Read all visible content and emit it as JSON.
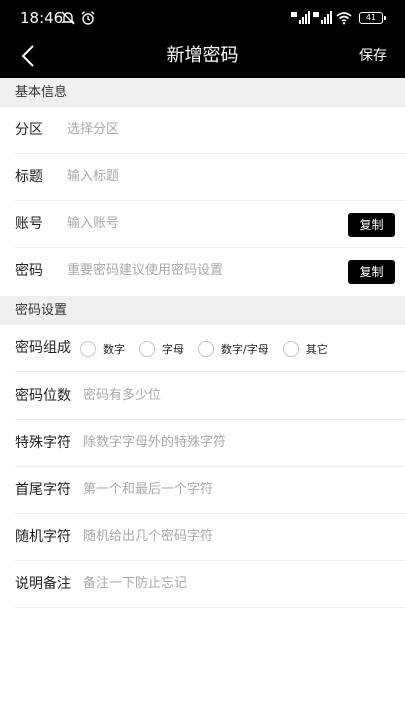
{
  "status_bar": {
    "time": "18:46",
    "battery": "41"
  },
  "nav": {
    "title": "新增密码",
    "save_label": "保存"
  },
  "sections": {
    "basic": "基本信息",
    "password_settings": "密码设置"
  },
  "basic_fields": {
    "partition": {
      "label": "分区",
      "placeholder": "选择分区"
    },
    "title": {
      "label": "标题",
      "placeholder": "输入标题"
    },
    "account": {
      "label": "账号",
      "placeholder": "输入账号",
      "button": "复制"
    },
    "password": {
      "label": "密码",
      "placeholder": "重要密码建议使用密码设置",
      "button": "复制"
    }
  },
  "composition": {
    "label": "密码组成",
    "options": [
      "数字",
      "字母",
      "数字/字母",
      "其它"
    ]
  },
  "setting_fields": {
    "length": {
      "label": "密码位数",
      "placeholder": "密码有多少位"
    },
    "special": {
      "label": "特殊字符",
      "placeholder": "除数字字母外的特殊字符"
    },
    "first_last": {
      "label": "首尾字符",
      "placeholder": "第一个和最后一个字符"
    },
    "random": {
      "label": "随机字符",
      "placeholder": "随机给出几个密码字符"
    },
    "notes": {
      "label": "说明备注",
      "placeholder": "备注一下防止忘记"
    }
  },
  "colors": {
    "bar_bg": "#000000",
    "section_bg": "#efefef",
    "button_bg": "#000000",
    "placeholder": "#a8a8a8"
  }
}
